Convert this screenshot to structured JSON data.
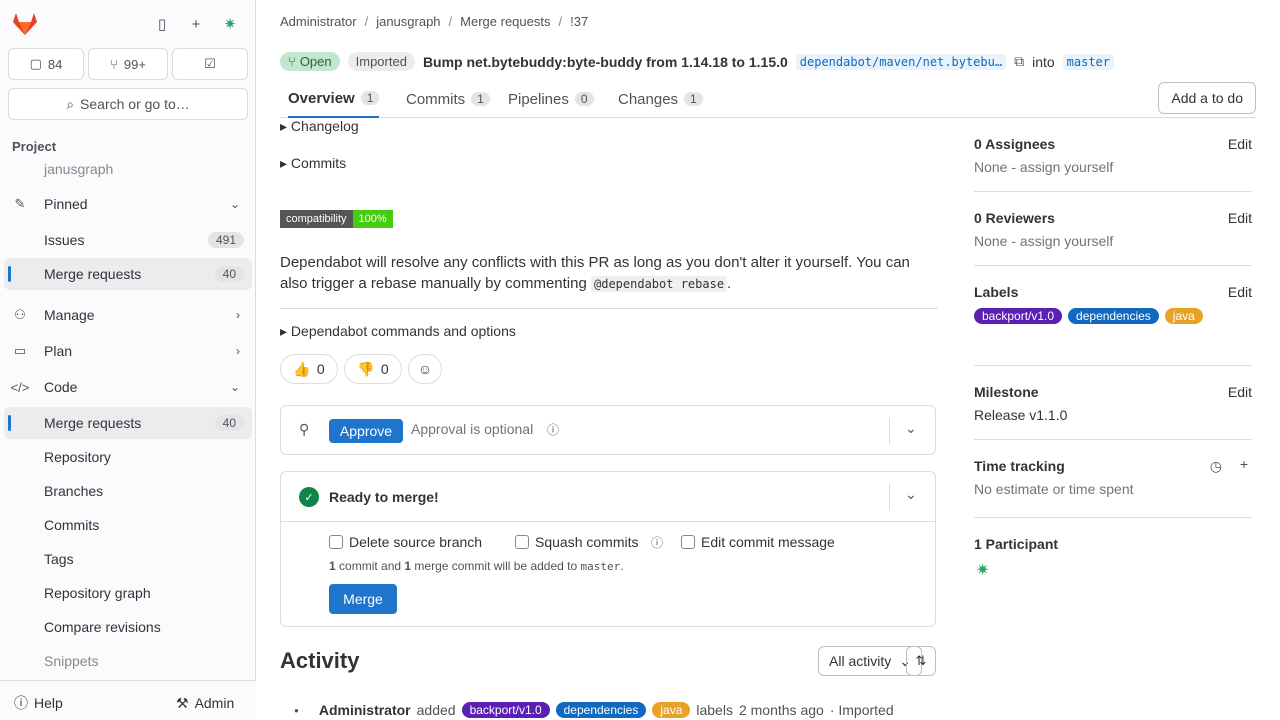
{
  "sidebar": {
    "counts": {
      "issues": "84",
      "mrs": "99+"
    },
    "search_label": "Search or go to…",
    "section_title": "Project",
    "project_name": "janusgraph",
    "items": [
      {
        "label": "Pinned",
        "icon": "pin-icon"
      },
      {
        "label": "Issues",
        "badge": "491"
      },
      {
        "label": "Merge requests",
        "badge": "40"
      },
      {
        "label": "Manage",
        "icon": "users-icon"
      },
      {
        "label": "Plan",
        "icon": "plan-icon"
      },
      {
        "label": "Code",
        "icon": "code-icon"
      },
      {
        "label": "Merge requests",
        "badge": "40"
      },
      {
        "label": "Repository"
      },
      {
        "label": "Branches"
      },
      {
        "label": "Commits"
      },
      {
        "label": "Tags"
      },
      {
        "label": "Repository graph"
      },
      {
        "label": "Compare revisions"
      },
      {
        "label": "Snippets"
      }
    ],
    "help_label": "Help",
    "admin_label": "Admin"
  },
  "breadcrumbs": [
    "Administrator",
    "janusgraph",
    "Merge requests",
    "!37"
  ],
  "mr": {
    "status": "Open",
    "imported": "Imported",
    "title": "Bump net.bytebuddy:byte-buddy from 1.14.18 to 1.15.0",
    "source_branch": "dependabot/maven/net.bytebu…",
    "into": "into",
    "target_branch": "master"
  },
  "tabs": [
    {
      "label": "Overview",
      "count": "1"
    },
    {
      "label": "Commits",
      "count": "1"
    },
    {
      "label": "Pipelines",
      "count": "0"
    },
    {
      "label": "Changes",
      "count": "1"
    }
  ],
  "add_todo": "Add a to do",
  "body": {
    "changelog": "Changelog",
    "commits": "Commits",
    "shield_left": "compatibility",
    "shield_right": "100%",
    "para_1": "Dependabot will resolve any conflicts with this PR as long as you don't alter it yourself. You can also trigger a rebase manually by commenting ",
    "para_code": "@dependabot rebase",
    "para_end": ".",
    "commands": "Dependabot commands and options",
    "thumbs_up": "0",
    "thumbs_down": "0"
  },
  "approval": {
    "approve_label": "Approve",
    "optional_text": "Approval is optional"
  },
  "merge": {
    "ready": "Ready to merge!",
    "delete_source": "Delete source branch",
    "squash": "Squash commits",
    "edit_msg": "Edit commit message",
    "commit_note_1": "1",
    "commit_note_2": " commit and ",
    "commit_note_3": "1",
    "commit_note_4": " merge commit will be added to ",
    "commit_note_branch": "master",
    "commit_note_end": ".",
    "merge_label": "Merge"
  },
  "activity": {
    "title": "Activity",
    "filter": "All activity",
    "feed_user": "Administrator",
    "feed_added": "added",
    "feed_labels": "labels",
    "feed_time": "2 months ago",
    "feed_imported": "· Imported"
  },
  "labels": [
    {
      "text": "backport/v1.0",
      "color": "#5c1fb3"
    },
    {
      "text": "dependencies",
      "color": "#1068bf"
    },
    {
      "text": "java",
      "color": "#e9a226"
    }
  ],
  "right": {
    "assignees_h": "0 Assignees",
    "assignees_v": "None - assign yourself",
    "reviewers_h": "0 Reviewers",
    "reviewers_v": "None - assign yourself",
    "labels_h": "Labels",
    "milestone_h": "Milestone",
    "milestone_v": "Release v1.1.0",
    "time_h": "Time tracking",
    "time_v": "No estimate or time spent",
    "participants_h": "1 Participant",
    "edit": "Edit"
  },
  "colors": {
    "accent": "#1f75cb",
    "success": "#108548"
  }
}
